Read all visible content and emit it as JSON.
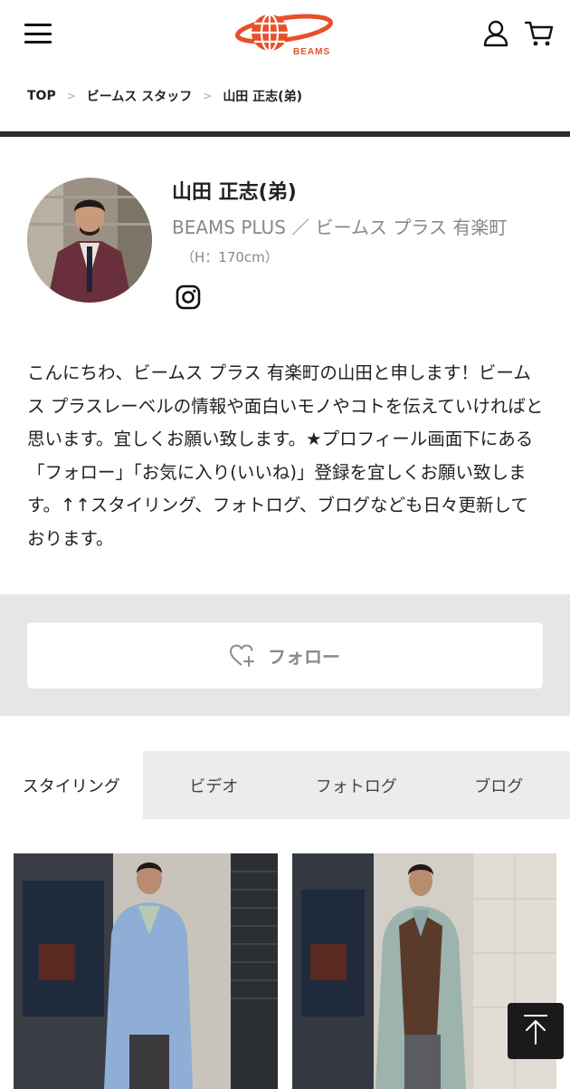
{
  "header": {
    "logo_text": "BEAMS",
    "menu_icon": "hamburger-menu-icon",
    "account_icon": "user-icon",
    "cart_icon": "cart-icon"
  },
  "breadcrumb": {
    "items": [
      "TOP",
      "ビームス スタッフ",
      "山田 正志(弟)"
    ],
    "separator": ">"
  },
  "profile": {
    "name": "山田 正志(弟)",
    "shop": "BEAMS PLUS ／ ビームス プラス 有楽町",
    "height": "（H：170cm）",
    "social_icon": "instagram-icon",
    "bio": "こんにちわ、ビームス プラス 有楽町の山田と申します！ビームス プラスレーベルの情報や面白いモノやコトを伝えていければと思います。宜しくお願い致します。★プロフィール画面下にある「フォロー」「お気に入り(いいね)」登録を宜しくお願い致します。↑↑スタイリング、フォトログ、ブログなども日々更新しております。"
  },
  "follow": {
    "label": "フォロー",
    "icon": "heart-plus-icon"
  },
  "tabs": [
    {
      "label": "スタイリング",
      "active": true
    },
    {
      "label": "ビデオ",
      "active": false
    },
    {
      "label": "フォトログ",
      "active": false
    },
    {
      "label": "ブログ",
      "active": false
    }
  ],
  "colors": {
    "logo_red": "#e84f2a",
    "divider": "#2b2b2b",
    "band_gray": "#e6e6e6",
    "tab_gray": "#ececec",
    "muted_text": "#888888"
  }
}
